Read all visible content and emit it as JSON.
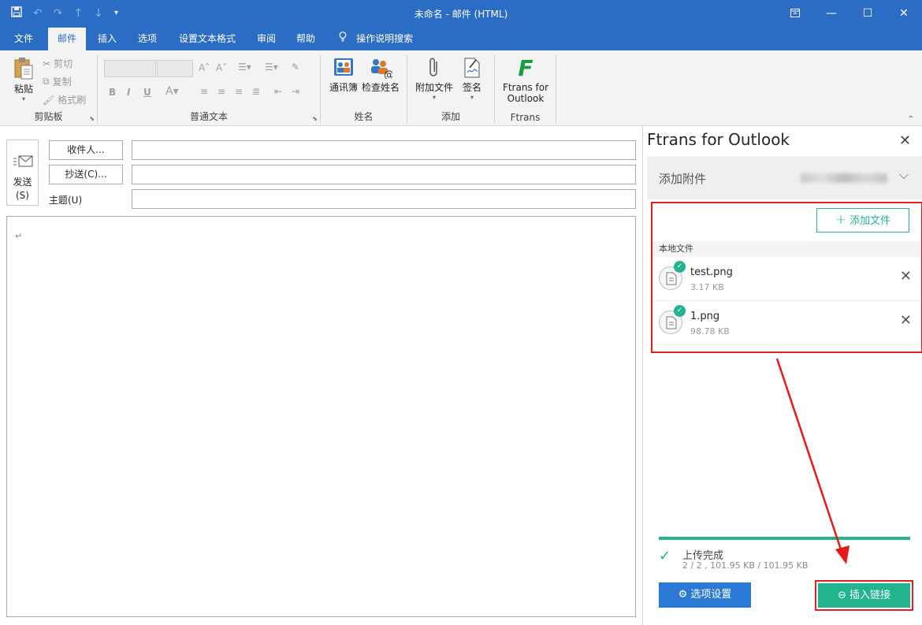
{
  "window": {
    "title": "未命名 - 邮件 (HTML)"
  },
  "tabs": [
    "文件",
    "邮件",
    "插入",
    "选项",
    "设置文本格式",
    "审阅",
    "帮助",
    "操作说明搜索"
  ],
  "ribbon": {
    "clipboard": {
      "paste": "粘贴",
      "cut": "剪切",
      "copy": "复制",
      "format_painter": "格式刷",
      "label": "剪贴板"
    },
    "basic_text": {
      "bold": "B",
      "italic": "I",
      "underline": "U",
      "label": "普通文本"
    },
    "names": {
      "address_book": "通讯簿",
      "check_names": "检查姓名",
      "label": "姓名"
    },
    "include": {
      "attach_file": "附加文件",
      "signature": "签名",
      "label": "添加"
    },
    "ftrans": {
      "button_line1": "Ftrans for",
      "button_line2": "Outlook",
      "label": "Ftrans",
      "logo": "F"
    }
  },
  "compose": {
    "send_line1": "发送",
    "send_line2": "(S)",
    "to_button": "收件人...",
    "cc_button": "抄送(C)...",
    "subject_label": "主题(U)",
    "to_value": "",
    "cc_value": "",
    "subject_value": "",
    "body_mark": "↵"
  },
  "panel": {
    "title": "Ftrans for Outlook",
    "section": "添加附件",
    "add_file": "添加文件",
    "local_files_header": "本地文件",
    "files": [
      {
        "name": "test.png",
        "size": "3.17 KB"
      },
      {
        "name": "1.png",
        "size": "98.78 KB"
      }
    ],
    "progress": 1.0,
    "status": "上传完成",
    "status_detail": "2 / 2 , 101.95 KB / 101.95 KB",
    "options_button": "选项设置",
    "insert_link_button": "插入链接"
  },
  "colors": {
    "titlebar": "#2b6cc4",
    "accent_green": "#22b38f",
    "options_blue": "#2b79d6",
    "annotation_red": "#e02020"
  }
}
